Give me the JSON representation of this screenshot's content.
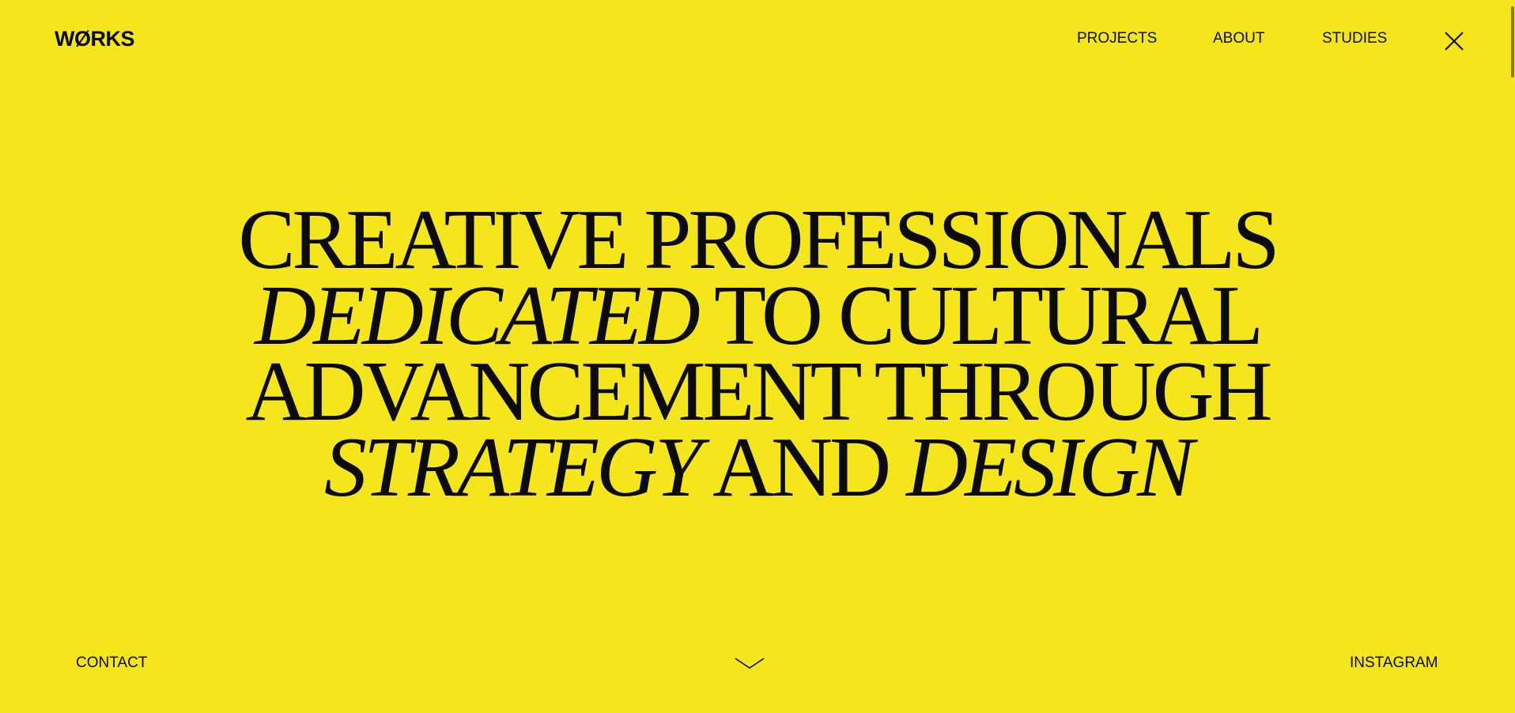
{
  "header": {
    "logo_text": "WØRKS"
  },
  "nav": {
    "items": [
      {
        "label": "PROJECTS"
      },
      {
        "label": "ABOUT"
      },
      {
        "label": "STUDIES"
      }
    ],
    "close_icon": "close-icon"
  },
  "hero": {
    "line1": "CREATIVE PROFESSIONALS",
    "line2_italic": "DEDICATED",
    "line2_rest": " TO CULTURAL",
    "line3": "ADVANCEMENT THROUGH",
    "line4_italic_a": "STRATEGY",
    "line4_mid": " AND ",
    "line4_italic_b": "DESIGN"
  },
  "footer": {
    "contact_label": "CONTACT",
    "instagram_label": "INSTAGRAM",
    "scroll_icon": "chevron-down-icon"
  },
  "colors": {
    "background": "#f5e51c",
    "text": "#0b0b0b"
  }
}
